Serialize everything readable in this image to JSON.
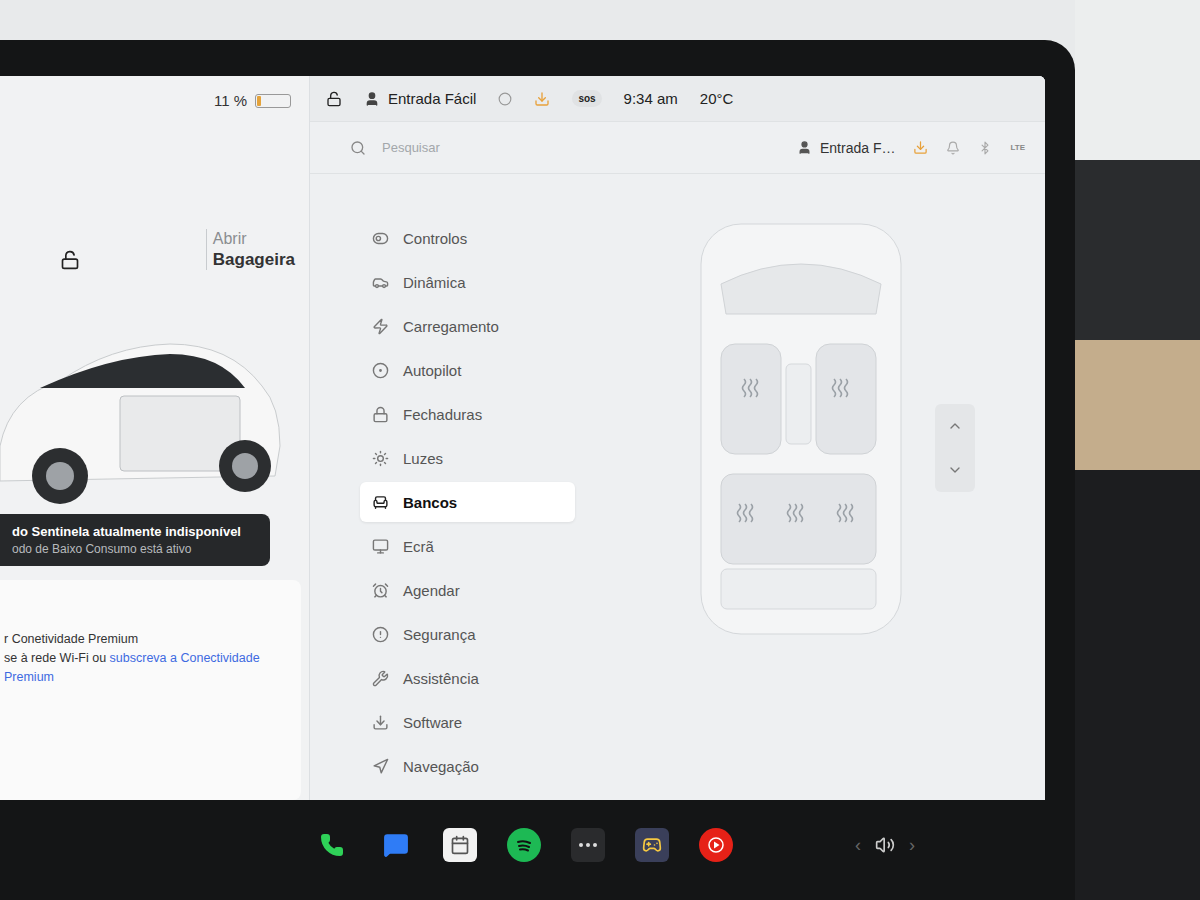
{
  "left_panel": {
    "battery": {
      "reading": "11 %",
      "level": 0.11
    },
    "trunk": {
      "action": "Abrir",
      "label": "Bagageira"
    },
    "notice": {
      "title": "do Sentinela atualmente indisponível",
      "subtitle": "odo de Baixo Consumo está ativo"
    },
    "connectivity": {
      "line1": "r Conetividade Premium",
      "line2": "se à rede Wi-Fi ou ",
      "link": "subscreva a Conectividade Premium"
    }
  },
  "status_bar": {
    "profile": "Entrada Fácil",
    "sos": "sos",
    "time": "9:34 am",
    "temperature": "20°C"
  },
  "header": {
    "search_placeholder": "Pesquisar",
    "profile": "Entrada F…",
    "signal": "LTE"
  },
  "menu": [
    {
      "label": "Controlos",
      "selected": false
    },
    {
      "label": "Dinâmica",
      "selected": false
    },
    {
      "label": "Carregamento",
      "selected": false
    },
    {
      "label": "Autopilot",
      "selected": false
    },
    {
      "label": "Fechaduras",
      "selected": false
    },
    {
      "label": "Luzes",
      "selected": false
    },
    {
      "label": "Bancos",
      "selected": true
    },
    {
      "label": "Ecrã",
      "selected": false
    },
    {
      "label": "Agendar",
      "selected": false
    },
    {
      "label": "Segurança",
      "selected": false
    },
    {
      "label": "Assistência",
      "selected": false
    },
    {
      "label": "Software",
      "selected": false
    },
    {
      "label": "Navegação",
      "selected": false
    }
  ],
  "seat_heaters": [
    {
      "level": 0
    },
    {
      "level": 0
    },
    {
      "level": 0
    },
    {
      "level": 0
    },
    {
      "level": 0
    }
  ],
  "volume": {
    "prev": "‹",
    "next": "›"
  }
}
